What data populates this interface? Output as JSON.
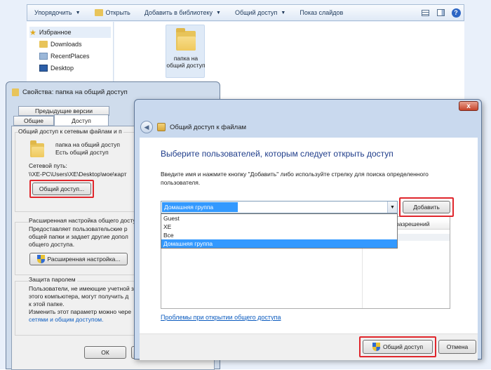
{
  "explorer": {
    "toolbar": {
      "organize": "Упорядочить",
      "open": "Открыть",
      "add_to_library": "Добавить в библиотеку",
      "share": "Общий доступ",
      "slideshow": "Показ слайдов"
    },
    "nav": {
      "favorites": "Избранное",
      "items": [
        "Downloads",
        "RecentPlaces",
        "Desktop"
      ]
    },
    "folder": {
      "label": "папка на общий доступ"
    }
  },
  "properties": {
    "title": "Свойства: папка на общий доступ",
    "tabs": {
      "previous_versions": "Предыдущие версии",
      "general": "Общие",
      "sharing": "Доступ"
    },
    "network": {
      "group_title": "Общий доступ к сетевым файлам и п",
      "folder_name": "папка на общий доступ",
      "folder_status": "Есть общий доступ",
      "path_label": "Сетевой путь:",
      "path_value": "\\\\XE-PC\\Users\\XE\\Desktop\\мое\\карт",
      "share_button": "Общий доступ..."
    },
    "advanced": {
      "group_title": "Расширенная настройка общего досту",
      "text_lines": [
        "Предоставляет пользовательские р",
        "общей папки и задает другие допол",
        "общего доступа."
      ],
      "button": "Расширенная настройка..."
    },
    "password": {
      "group_title": "Защита паролем",
      "text_lines": [
        "Пользователи, не имеющие учетной з",
        "этого компьютера, могут получить д",
        "к этой папке."
      ],
      "change_line": "Изменить этот параметр можно чере",
      "link": "сетями и общим доступом."
    },
    "ok_button": "ОК"
  },
  "wizard": {
    "title": "Общий доступ к файлам",
    "close_glyph": "x",
    "heading": "Выберите пользователей, которым следует открыть доступ",
    "instructions_line1": "Введите имя и нажмите кнопку \"Добавить\" либо используйте стрелку для поиска определенного",
    "instructions_line2": "пользователя.",
    "combo_value": "Домашняя группа",
    "dropdown_options": [
      "Guest",
      "XE",
      "Все",
      "Домашняя группа"
    ],
    "dropdown_selected": "Домашняя группа",
    "add_button": "Добавить",
    "grid_column": "разрешений",
    "problems_link": "Проблемы при открытии общего доступа",
    "share_button": "Общий доступ",
    "cancel_button": "Отмена"
  },
  "colors": {
    "accent": "#3399ff",
    "heading": "#1f3d8a",
    "link": "#0b5bbf",
    "highlight_frame": "#e0262c"
  }
}
